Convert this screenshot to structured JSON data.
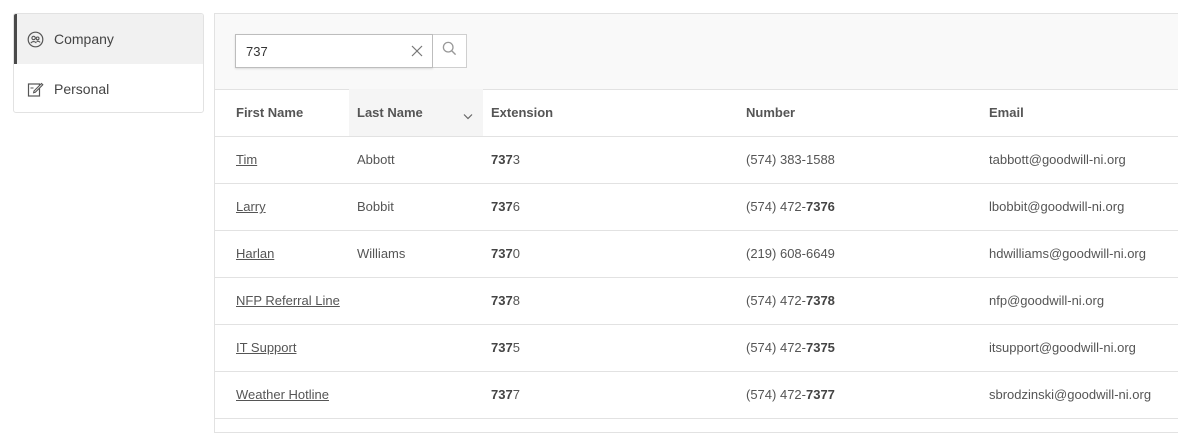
{
  "sidebar": {
    "items": [
      {
        "label": "Company",
        "icon": "company-users-icon",
        "active": true
      },
      {
        "label": "Personal",
        "icon": "edit-contact-icon",
        "active": false
      }
    ]
  },
  "search": {
    "value": "737",
    "placeholder": ""
  },
  "table": {
    "columns": [
      "First Name",
      "Last Name",
      "Extension",
      "Number",
      "Email"
    ],
    "sorted_column": "Last Name",
    "rows": [
      {
        "first": "Tim",
        "last": "Abbott",
        "ext_hl": "737",
        "ext_rest": "3",
        "num_pre": "(574) 383-1588",
        "num_hl": "",
        "email": "tabbott@goodwill-ni.org"
      },
      {
        "first": "Larry",
        "last": "Bobbit",
        "ext_hl": "737",
        "ext_rest": "6",
        "num_pre": "(574) 472-",
        "num_hl": "7376",
        "email": "lbobbit@goodwill-ni.org"
      },
      {
        "first": "Harlan",
        "last": "Williams",
        "ext_hl": "737",
        "ext_rest": "0",
        "num_pre": "(219) 608-6649",
        "num_hl": "",
        "email": "hdwilliams@goodwill-ni.org"
      },
      {
        "first": "NFP Referral Line",
        "last": "",
        "ext_hl": "737",
        "ext_rest": "8",
        "num_pre": "(574) 472-",
        "num_hl": "7378",
        "email": "nfp@goodwill-ni.org"
      },
      {
        "first": "IT Support",
        "last": "",
        "ext_hl": "737",
        "ext_rest": "5",
        "num_pre": "(574) 472-",
        "num_hl": "7375",
        "email": "itsupport@goodwill-ni.org"
      },
      {
        "first": "Weather Hotline",
        "last": "",
        "ext_hl": "737",
        "ext_rest": "7",
        "num_pre": "(574) 472-",
        "num_hl": "7377",
        "email": "sbrodzinski@goodwill-ni.org"
      }
    ]
  }
}
